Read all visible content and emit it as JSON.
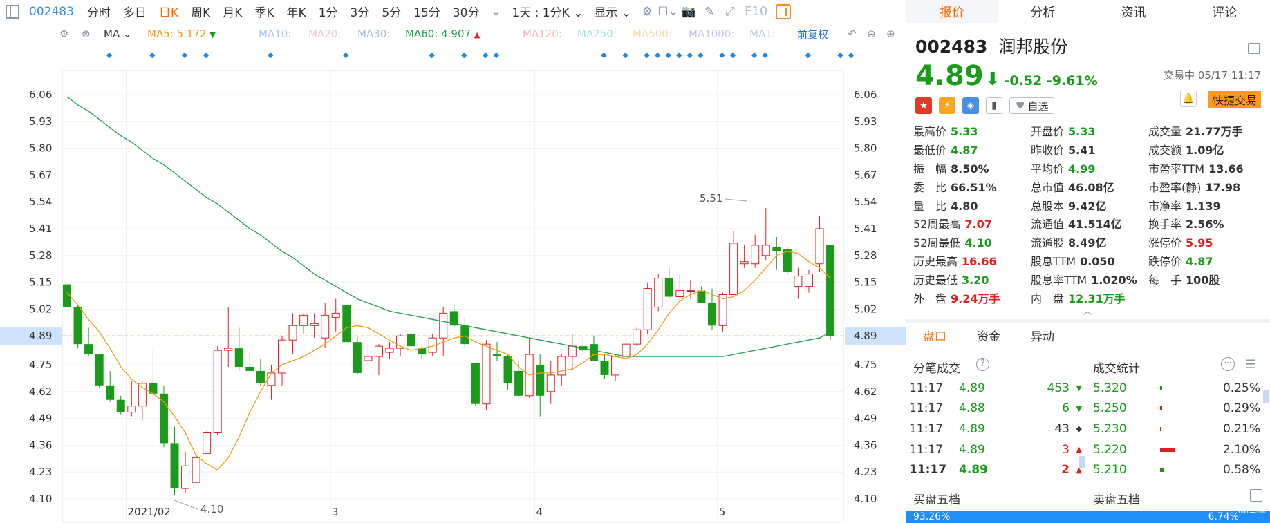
{
  "toolbar": {
    "code": "002483",
    "periods": [
      "分时",
      "多日",
      "日K",
      "周K",
      "月K",
      "季K",
      "年K",
      "1分",
      "3分",
      "5分",
      "15分",
      "30分"
    ],
    "active_period": "日K",
    "range_select": "1天 : 1分K",
    "display_label": "显示",
    "f10_label": "F10"
  },
  "ma_bar": {
    "type": "MA",
    "ma5_label": "MA5:",
    "ma5_value": "5.172",
    "ma10": "MA10:",
    "ma20": "MA20:",
    "ma30": "MA30:",
    "ma60_label": "MA60:",
    "ma60_value": "4.907",
    "ma120": "MA120:",
    "ma250": "MA250:",
    "ma500": "MA500:",
    "ma1000": "MA1000:",
    "ma1": "MA1:",
    "adjust_label": "前复权",
    "colors": {
      "ma5": "#f39c12",
      "ma10": "#7fb0e8",
      "ma20": "#f3a7c0",
      "ma30": "#8aa6d8",
      "ma60": "#20a050",
      "ma120": "#f39aa0",
      "ma250": "#7fd3e8",
      "ma500": "#f3d07f",
      "ma1000": "#b9a6e8",
      "ma1": "#a0b0c0"
    }
  },
  "chart_data": {
    "type": "candlestick",
    "y_ticks": [
      "6.06",
      "5.93",
      "5.80",
      "5.67",
      "5.54",
      "5.41",
      "5.28",
      "5.15",
      "5.02",
      "4.89",
      "4.75",
      "4.62",
      "4.49",
      "4.36",
      "4.23",
      "4.10"
    ],
    "ylim": [
      4.1,
      6.06
    ],
    "x_labels": [
      "2021/02",
      "3",
      "4",
      "5"
    ],
    "current_price_label": "4.89",
    "max_label": "5.51",
    "min_label": "4.10",
    "up_color": "#e02020",
    "down_color": "#1a9b1a",
    "candles": [
      [
        5.14,
        5.14,
        5.03,
        5.03
      ],
      [
        5.03,
        5.04,
        4.83,
        4.85
      ],
      [
        4.85,
        4.93,
        4.79,
        4.8
      ],
      [
        4.8,
        4.8,
        4.64,
        4.65
      ],
      [
        4.65,
        4.72,
        4.57,
        4.58
      ],
      [
        4.58,
        4.6,
        4.51,
        4.52
      ],
      [
        4.52,
        4.67,
        4.5,
        4.55
      ],
      [
        4.55,
        4.67,
        4.48,
        4.66
      ],
      [
        4.66,
        4.82,
        4.6,
        4.61
      ],
      [
        4.61,
        4.65,
        4.35,
        4.37
      ],
      [
        4.37,
        4.45,
        4.12,
        4.15
      ],
      [
        4.15,
        4.33,
        4.13,
        4.26
      ],
      [
        4.18,
        4.33,
        4.17,
        4.3
      ],
      [
        4.32,
        4.43,
        4.32,
        4.42
      ],
      [
        4.42,
        4.84,
        4.41,
        4.82
      ],
      [
        4.82,
        5.03,
        4.74,
        4.83
      ],
      [
        4.83,
        4.93,
        4.72,
        4.74
      ],
      [
        4.74,
        4.81,
        4.72,
        4.72
      ],
      [
        4.72,
        4.78,
        4.65,
        4.66
      ],
      [
        4.65,
        4.75,
        4.58,
        4.71
      ],
      [
        4.71,
        4.89,
        4.65,
        4.87
      ],
      [
        4.87,
        5.0,
        4.8,
        4.94
      ],
      [
        4.94,
        5.0,
        4.9,
        4.99
      ],
      [
        4.94,
        5.0,
        4.88,
        4.95
      ],
      [
        4.88,
        5.05,
        4.83,
        4.99
      ],
      [
        4.98,
        5.07,
        4.91,
        5.0
      ],
      [
        5.04,
        5.04,
        4.86,
        4.86
      ],
      [
        4.86,
        4.89,
        4.7,
        4.71
      ],
      [
        4.77,
        4.85,
        4.75,
        4.79
      ],
      [
        4.79,
        4.85,
        4.7,
        4.84
      ],
      [
        4.81,
        4.86,
        4.78,
        4.83
      ],
      [
        4.83,
        4.9,
        4.79,
        4.89
      ],
      [
        4.9,
        4.91,
        4.84,
        4.84
      ],
      [
        4.83,
        4.84,
        4.78,
        4.8
      ],
      [
        4.81,
        4.9,
        4.79,
        4.88
      ],
      [
        4.88,
        5.03,
        4.79,
        5.0
      ],
      [
        5.01,
        5.04,
        4.93,
        4.94
      ],
      [
        4.94,
        4.98,
        4.83,
        4.85
      ],
      [
        4.76,
        4.76,
        4.55,
        4.56
      ],
      [
        4.56,
        4.87,
        4.53,
        4.85
      ],
      [
        4.8,
        4.86,
        4.77,
        4.79
      ],
      [
        4.79,
        4.8,
        4.63,
        4.66
      ],
      [
        4.72,
        4.77,
        4.59,
        4.6
      ],
      [
        4.6,
        4.88,
        4.59,
        4.8
      ],
      [
        4.75,
        4.8,
        4.5,
        4.6
      ],
      [
        4.62,
        4.77,
        4.56,
        4.7
      ],
      [
        4.7,
        4.8,
        4.65,
        4.79
      ],
      [
        4.79,
        4.9,
        4.72,
        4.84
      ],
      [
        4.84,
        4.89,
        4.8,
        4.82
      ],
      [
        4.85,
        4.89,
        4.77,
        4.77
      ],
      [
        4.77,
        4.8,
        4.68,
        4.7
      ],
      [
        4.7,
        4.8,
        4.67,
        4.79
      ],
      [
        4.79,
        4.88,
        4.76,
        4.85
      ],
      [
        4.85,
        4.93,
        4.84,
        4.92
      ],
      [
        4.92,
        5.15,
        4.9,
        5.12
      ],
      [
        5.03,
        5.19,
        5.01,
        5.17
      ],
      [
        5.17,
        5.22,
        5.07,
        5.08
      ],
      [
        5.08,
        5.19,
        5.06,
        5.11
      ],
      [
        5.11,
        5.16,
        5.07,
        5.11
      ],
      [
        5.11,
        5.13,
        5.05,
        5.05
      ],
      [
        5.05,
        5.12,
        4.92,
        4.94
      ],
      [
        4.94,
        5.1,
        4.91,
        5.09
      ],
      [
        5.09,
        5.4,
        5.09,
        5.34
      ],
      [
        5.24,
        5.33,
        5.22,
        5.25
      ],
      [
        5.24,
        5.38,
        5.22,
        5.33
      ],
      [
        5.28,
        5.51,
        5.26,
        5.33
      ],
      [
        5.32,
        5.37,
        5.21,
        5.3
      ],
      [
        5.31,
        5.32,
        5.19,
        5.2
      ],
      [
        5.13,
        5.22,
        5.07,
        5.18
      ],
      [
        5.13,
        5.21,
        5.1,
        5.19
      ],
      [
        5.24,
        5.47,
        5.2,
        5.41
      ],
      [
        5.33,
        5.33,
        4.87,
        4.89
      ]
    ],
    "ma5": [
      5.1,
      5.04,
      4.97,
      4.91,
      4.83,
      4.74,
      4.68,
      4.64,
      4.61,
      4.57,
      4.5,
      4.42,
      4.31,
      4.27,
      4.24,
      4.3,
      4.4,
      4.52,
      4.62,
      4.71,
      4.75,
      4.77,
      4.79,
      4.82,
      4.85,
      4.89,
      4.93,
      4.94,
      4.93,
      4.9,
      4.87,
      4.84,
      4.82,
      4.83,
      4.84,
      4.86,
      4.88,
      4.89,
      4.86,
      4.84,
      4.82,
      4.8,
      4.74,
      4.7,
      4.71,
      4.71,
      4.72,
      4.73,
      4.76,
      4.8,
      4.8,
      4.79,
      4.78,
      4.8,
      4.85,
      4.92,
      5.0,
      5.06,
      5.09,
      5.11,
      5.09,
      5.07,
      5.08,
      5.11,
      5.16,
      5.22,
      5.28,
      5.3,
      5.29,
      5.25,
      5.22,
      5.17
    ],
    "ma60": [
      6.05,
      6.01,
      5.98,
      5.94,
      5.9,
      5.86,
      5.83,
      5.79,
      5.75,
      5.72,
      5.68,
      5.64,
      5.6,
      5.56,
      5.53,
      5.49,
      5.45,
      5.41,
      5.38,
      5.34,
      5.3,
      5.27,
      5.23,
      5.19,
      5.16,
      5.13,
      5.1,
      5.07,
      5.05,
      5.03,
      5.01,
      5.0,
      4.99,
      4.98,
      4.97,
      4.96,
      4.95,
      4.94,
      4.93,
      4.92,
      4.91,
      4.9,
      4.89,
      4.88,
      4.87,
      4.86,
      4.85,
      4.84,
      4.83,
      4.82,
      4.81,
      4.8,
      4.79,
      4.79,
      4.79,
      4.79,
      4.79,
      4.79,
      4.79,
      4.79,
      4.79,
      4.79,
      4.8,
      4.81,
      4.82,
      4.83,
      4.84,
      4.85,
      4.86,
      4.87,
      4.88,
      4.907
    ]
  },
  "quote": {
    "code": "002483",
    "name": "润邦股份",
    "price": "4.89",
    "change": "-0.52",
    "change_pct": "-9.61%",
    "status_time": "交易中 05/17 11:17",
    "zixuan": "自选",
    "fast_trade": "快捷交易"
  },
  "tabs": [
    "报价",
    "分析",
    "资讯",
    "评论"
  ],
  "stats": [
    [
      {
        "k": "最高价",
        "v": "5.33",
        "c": "down"
      },
      {
        "k": "开盘价",
        "v": "5.33",
        "c": "down"
      },
      {
        "k": "成交量",
        "v": "21.77万手",
        "c": "neu"
      }
    ],
    [
      {
        "k": "最低价",
        "v": "4.87",
        "c": "down"
      },
      {
        "k": "昨收价",
        "v": "5.41",
        "c": "neu"
      },
      {
        "k": "成交额",
        "v": "1.09亿",
        "c": "neu"
      }
    ],
    [
      {
        "k": "振　幅",
        "v": "8.50%",
        "c": "neu"
      },
      {
        "k": "平均价",
        "v": "4.99",
        "c": "down"
      },
      {
        "k": "市盈率TTM",
        "v": "13.66",
        "c": "neu"
      }
    ],
    [
      {
        "k": "委　比",
        "v": "66.51%",
        "c": "neu"
      },
      {
        "k": "总市值",
        "v": "46.08亿",
        "c": "neu"
      },
      {
        "k": "市盈率(静)",
        "v": "17.98",
        "c": "neu"
      }
    ],
    [
      {
        "k": "量　比",
        "v": "4.80",
        "c": "neu"
      },
      {
        "k": "总股本",
        "v": "9.42亿",
        "c": "neu"
      },
      {
        "k": "市净率",
        "v": "1.139",
        "c": "neu"
      }
    ],
    [
      {
        "k": "52周最高",
        "v": "7.07",
        "c": "up"
      },
      {
        "k": "流通值",
        "v": "41.514亿",
        "c": "neu"
      },
      {
        "k": "换手率",
        "v": "2.56%",
        "c": "neu"
      }
    ],
    [
      {
        "k": "52周最低",
        "v": "4.10",
        "c": "down"
      },
      {
        "k": "流通股",
        "v": "8.49亿",
        "c": "neu"
      },
      {
        "k": "涨停价",
        "v": "5.95",
        "c": "up"
      }
    ],
    [
      {
        "k": "历史最高",
        "v": "16.66",
        "c": "up"
      },
      {
        "k": "股息TTM",
        "v": "0.050",
        "c": "neu"
      },
      {
        "k": "跌停价",
        "v": "4.87",
        "c": "down"
      }
    ],
    [
      {
        "k": "历史最低",
        "v": "3.20",
        "c": "down"
      },
      {
        "k": "股息率TTM",
        "v": "1.020%",
        "c": "neu"
      },
      {
        "k": "每　手",
        "v": "100股",
        "c": "neu"
      }
    ],
    [
      {
        "k": "外　盘",
        "v": "9.24万手",
        "c": "up"
      },
      {
        "k": "内　盘",
        "v": "12.31万手",
        "c": "down"
      },
      null
    ]
  ],
  "sub_tabs": [
    "盘口",
    "资金",
    "异动"
  ],
  "ticks_title": "分笔成交",
  "vol_title": "成交统计",
  "ticks": [
    {
      "t": "11:17",
      "p": "4.89",
      "v": "453",
      "d": "down"
    },
    {
      "t": "11:17",
      "p": "4.88",
      "v": "6",
      "d": "down"
    },
    {
      "t": "11:17",
      "p": "4.89",
      "v": "43",
      "d": "neu"
    },
    {
      "t": "11:17",
      "p": "4.89",
      "v": "3",
      "d": "up"
    },
    {
      "t": "11:17",
      "p": "4.89",
      "v": "2",
      "d": "up"
    }
  ],
  "vol_stats": [
    {
      "p": "5.320",
      "pct": "0.25%",
      "share": 0.25,
      "c": "down"
    },
    {
      "p": "5.250",
      "pct": "0.29%",
      "share": 0.29,
      "c": "up"
    },
    {
      "p": "5.230",
      "pct": "0.21%",
      "share": 0.21,
      "c": "up"
    },
    {
      "p": "5.220",
      "pct": "2.10%",
      "share": 2.1,
      "c": "up"
    },
    {
      "p": "5.210",
      "pct": "0.58%",
      "share": 0.58,
      "c": "down"
    }
  ],
  "book": {
    "buy_title": "买盘五档",
    "sell_title": "卖盘五档",
    "buy_pct": "93.26%",
    "sell_pct": "6.74%",
    "buy_share": 93.26,
    "sell_share": 6.74
  },
  "watermark": "格隆汇"
}
